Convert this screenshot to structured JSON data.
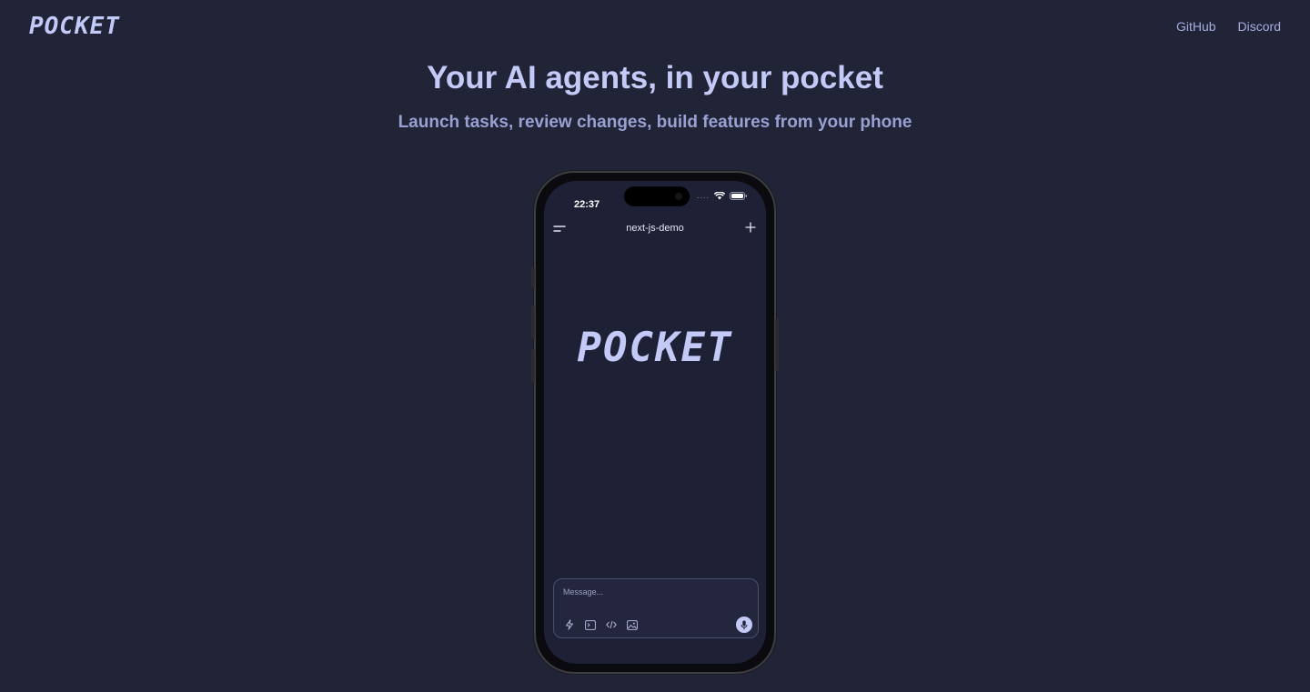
{
  "header": {
    "logo": "POCKET",
    "nav": [
      {
        "label": "GitHub"
      },
      {
        "label": "Discord"
      }
    ]
  },
  "hero": {
    "title": "Your AI agents, in your pocket",
    "subtitle": "Launch tasks, review changes, build features from your phone"
  },
  "phone": {
    "status": {
      "time": "22:37",
      "signal": "...."
    },
    "app_header": {
      "title": "next-js-demo"
    },
    "logo": "POCKET",
    "composer": {
      "placeholder": "Message...",
      "tools": [
        "lightning-icon",
        "terminal-icon",
        "code-icon",
        "image-icon"
      ],
      "mic": "microphone-icon"
    }
  },
  "colors": {
    "background": "#212337",
    "accent": "#c4caf7",
    "muted": "#99a1d2",
    "screen": "#1e2136"
  }
}
